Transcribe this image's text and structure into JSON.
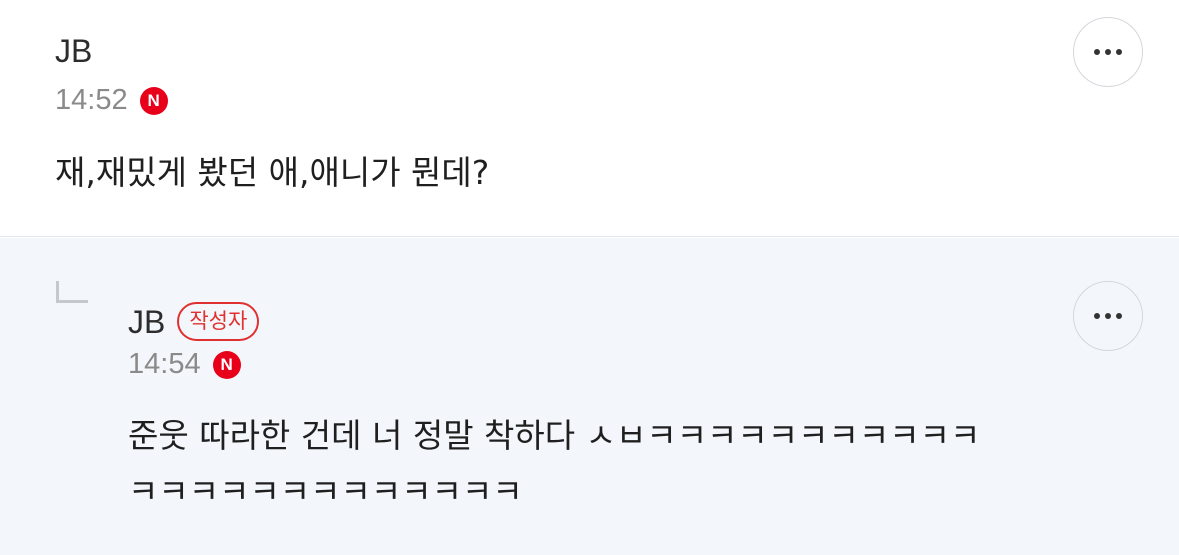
{
  "comments": [
    {
      "author": "JB",
      "time": "14:52",
      "badge": "N",
      "text": "재,재밌게 봤던 애,애니가 뭔데?",
      "more_icon": "more-horizontal-icon"
    }
  ],
  "reply": {
    "author": "JB",
    "author_tag": "작성자",
    "time": "14:54",
    "badge": "N",
    "text_line1": "준웃 따라한 건데 너 정말 착하다 ㅅㅂㅋㅋㅋㅋㅋㅋㅋㅋㅋㅋㅋ",
    "text_line2": "ㅋㅋㅋㅋㅋㅋㅋㅋㅋㅋㅋㅋㅋ",
    "more_icon": "more-horizontal-icon"
  },
  "colors": {
    "badge_red": "#e8001a",
    "reply_background": "#f3f7fb",
    "writer_tag": "#e03030"
  }
}
